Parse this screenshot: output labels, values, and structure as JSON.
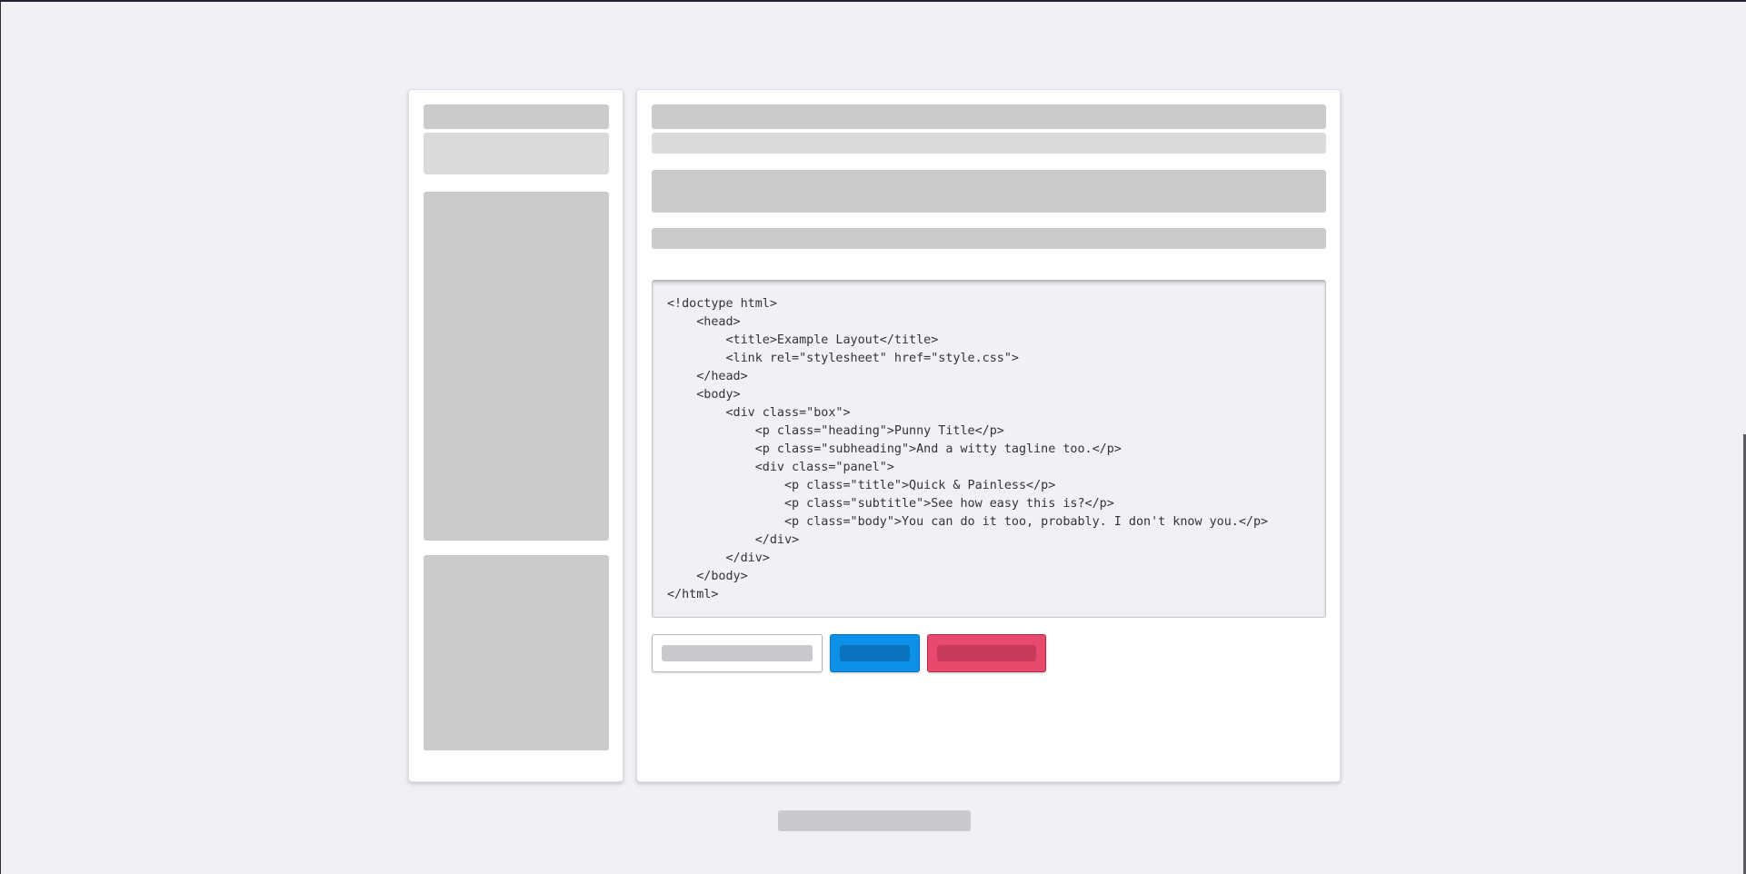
{
  "code_editor": {
    "lines": [
      "<!doctype html>",
      "    <head>",
      "        <title>Example Layout</title>",
      "        <link rel=\"stylesheet\" href=\"style.css\">",
      "    </head>",
      "    <body>",
      "        <div class=\"box\">",
      "            <p class=\"heading\">Punny Title</p>",
      "            <p class=\"subheading\">And a witty tagline too.</p>",
      "            <div class=\"panel\">",
      "                <p class=\"title\">Quick & Painless</p>",
      "                <p class=\"subtitle\">See how easy this is?</p>",
      "                <p class=\"body\">You can do it too, probably. I don't know you.</p>",
      "            </div>",
      "        </div>",
      "    </body>",
      "</html>"
    ]
  },
  "colors": {
    "page_background": "#f1f0f5",
    "primary_button": "#0c90e8",
    "danger_button": "#e84a6e",
    "placeholder": "#cbcbcb"
  }
}
